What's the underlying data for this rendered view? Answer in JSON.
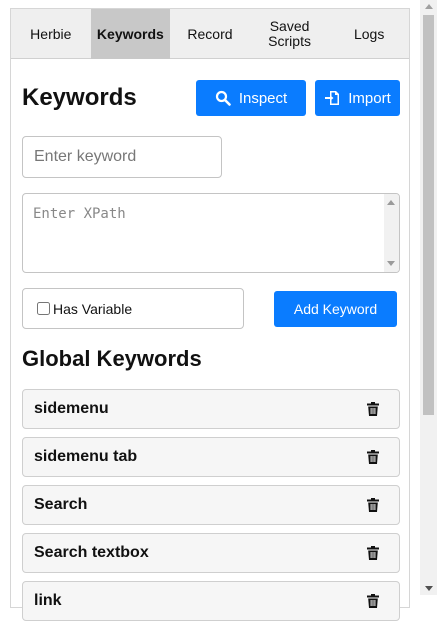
{
  "tabs": [
    {
      "label": "Herbie",
      "active": false
    },
    {
      "label": "Keywords",
      "active": true
    },
    {
      "label": "Record",
      "active": false
    },
    {
      "label": "Saved Scripts",
      "active": false
    },
    {
      "label": "Logs",
      "active": false
    }
  ],
  "header": {
    "title": "Keywords",
    "inspect_label": "Inspect",
    "inspect_icon": "search-icon",
    "import_label": "Import",
    "import_icon": "import-icon"
  },
  "form": {
    "keyword_placeholder": "Enter keyword",
    "keyword_value": "",
    "xpath_placeholder": "Enter XPath",
    "xpath_value": "",
    "has_variable_label": "Has Variable",
    "has_variable_checked": false,
    "add_button_label": "Add Keyword"
  },
  "global": {
    "title": "Global Keywords",
    "items": [
      {
        "label": "sidemenu"
      },
      {
        "label": "sidemenu tab"
      },
      {
        "label": "Search"
      },
      {
        "label": "Search textbox"
      },
      {
        "label": "link"
      }
    ]
  },
  "colors": {
    "accent": "#0a7cff",
    "tab_active": "#c8c8c8",
    "tab_bar": "#efefef"
  }
}
